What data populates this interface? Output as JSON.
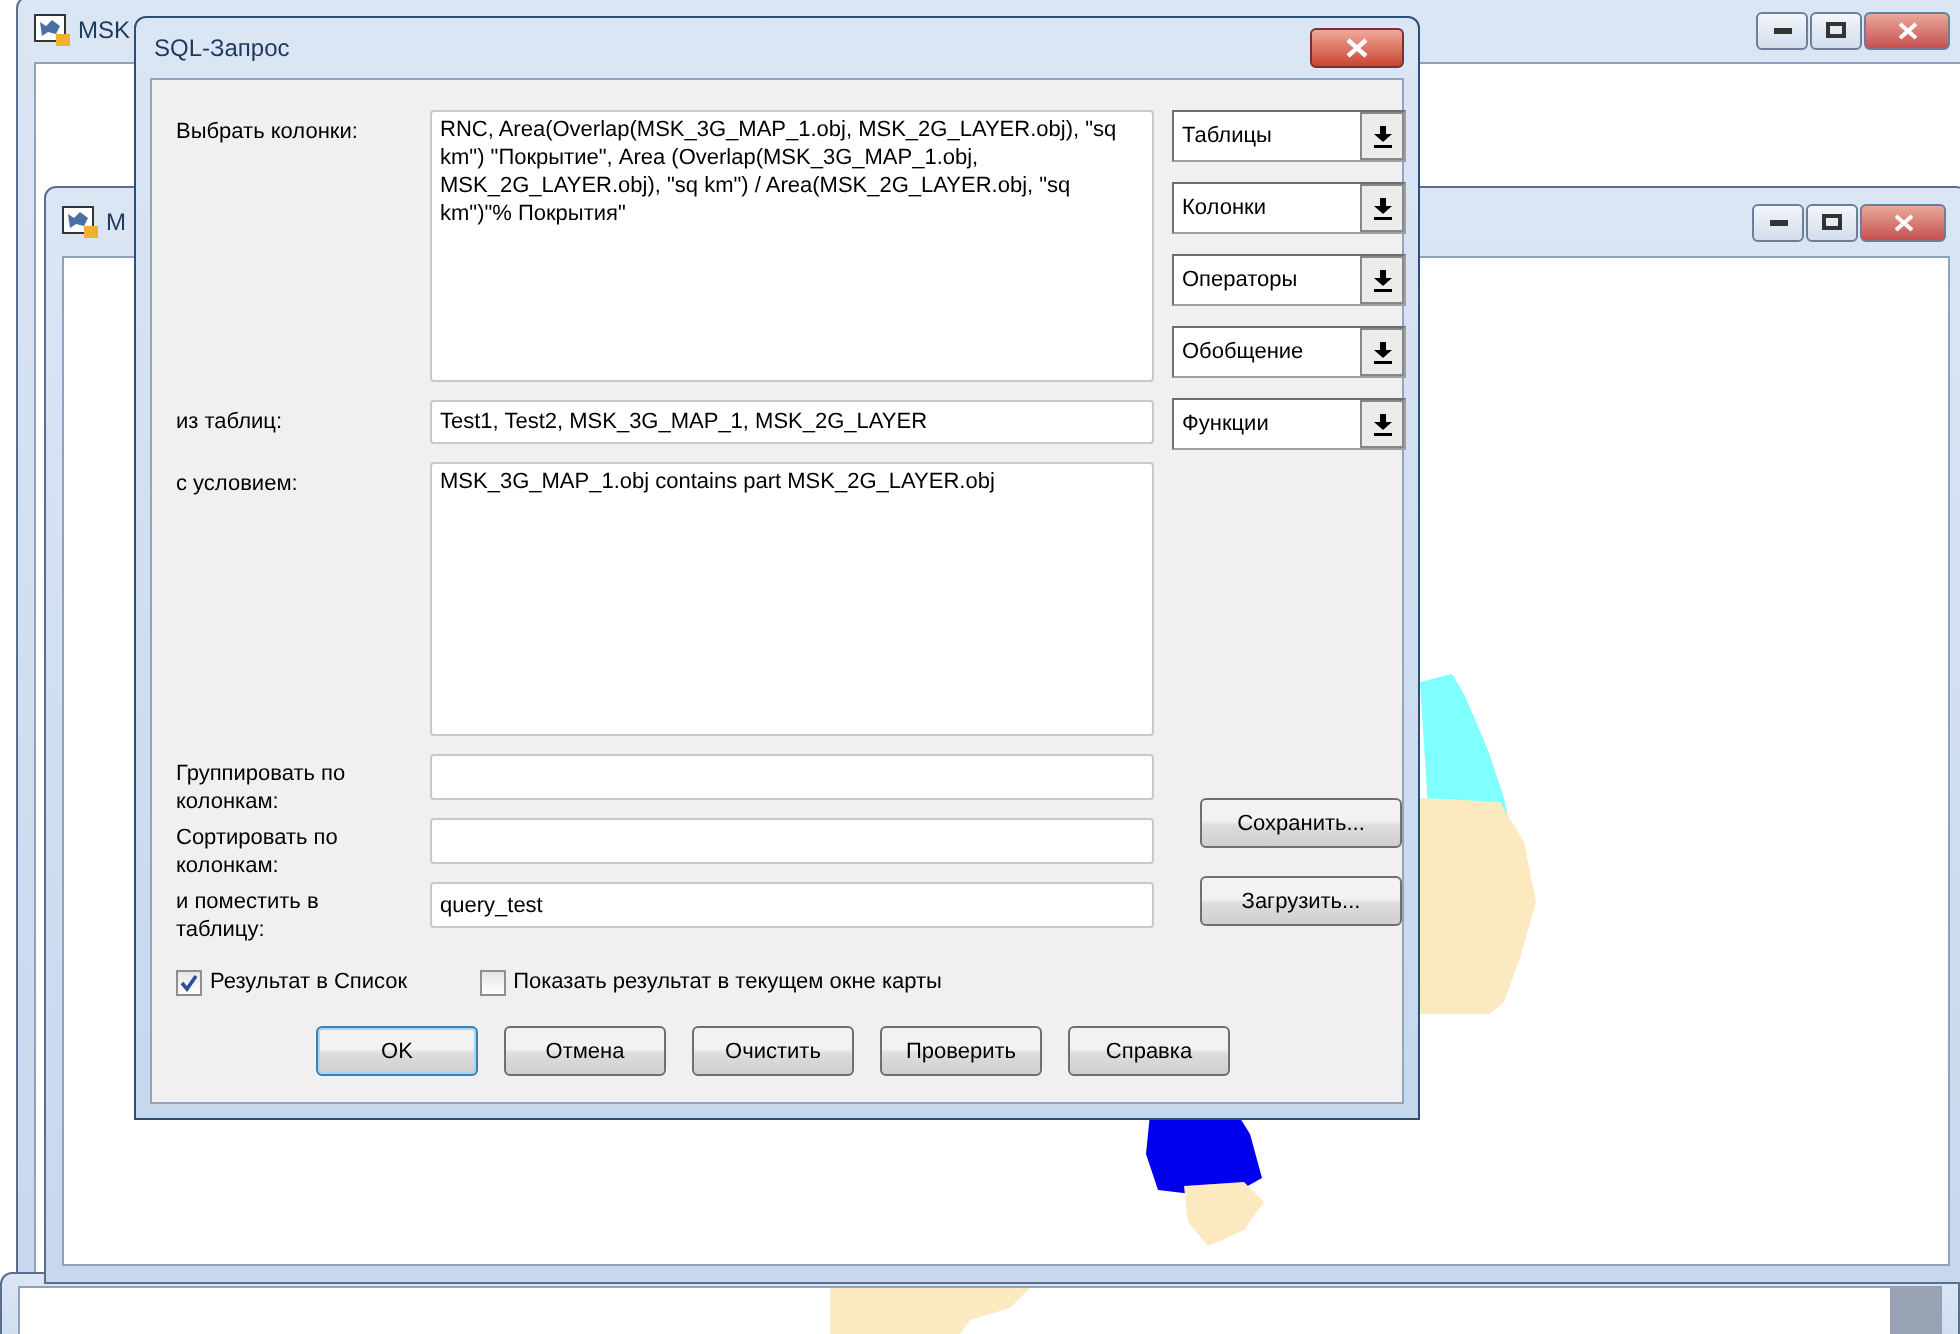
{
  "windows": [
    {
      "title": "MSK"
    },
    {
      "title": "M"
    }
  ],
  "dialog": {
    "title": "SQL-Запрос",
    "fields": [
      {
        "kind": "multiline",
        "label": "Выбрать колонки:",
        "value": "RNC, Area(Overlap(MSK_3G_MAP_1.obj, MSK_2G_LAYER.obj), \"sq km\") \"Покрытие\", Area (Overlap(MSK_3G_MAP_1.obj, MSK_2G_LAYER.obj), \"sq km\") / Area(MSK_2G_LAYER.obj, \"sq km\")\"% Покрытия\""
      },
      {
        "kind": "line",
        "label": "из таблиц:",
        "value": "Test1, Test2, MSK_3G_MAP_1, MSK_2G_LAYER"
      },
      {
        "kind": "multiline",
        "label": "с условием:",
        "value": "MSK_3G_MAP_1.obj contains part MSK_2G_LAYER.obj"
      },
      {
        "kind": "line",
        "label": "Группировать по колонкам:"
      },
      {
        "kind": "line",
        "label": "Сортировать по колонкам:"
      },
      {
        "kind": "line",
        "label": "и поместить в таблицу:",
        "value": "query_test"
      }
    ],
    "dropdowns": [
      "Таблицы",
      "Колонки",
      "Операторы",
      "Обобщение",
      "Функции"
    ],
    "side_buttons": [
      "Сохранить...",
      "Загрузить..."
    ],
    "checkboxes": [
      {
        "label": "Результат в Список",
        "checked": true
      },
      {
        "label": "Показать результат в текущем окне карты",
        "checked": false
      }
    ],
    "buttons": [
      {
        "label": "OK",
        "default": true
      },
      {
        "label": "Отмена",
        "default": false
      },
      {
        "label": "Очистить",
        "default": false
      },
      {
        "label": "Проверить",
        "default": false
      },
      {
        "label": "Справка",
        "default": false
      }
    ]
  }
}
